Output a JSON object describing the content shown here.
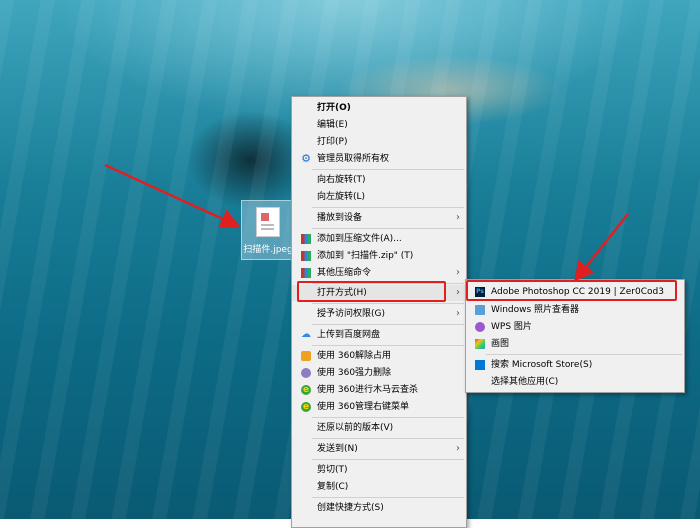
{
  "desktop": {
    "file_icon_label": "扫描件.jpeg"
  },
  "context_menu": {
    "items": [
      {
        "label": "打开(O)",
        "icon": ""
      },
      {
        "label": "编辑(E)",
        "icon": ""
      },
      {
        "label": "打印(P)",
        "icon": ""
      },
      {
        "label": "管理员取得所有权",
        "icon": "gear-icon"
      },
      {
        "label": "向右旋转(T)",
        "icon": ""
      },
      {
        "label": "向左旋转(L)",
        "icon": ""
      },
      {
        "label": "播放到设备",
        "icon": "",
        "submenu": true
      },
      {
        "label": "添加到压缩文件(A)...",
        "icon": "archive-icon"
      },
      {
        "label": "添加到 \"扫描件.zip\" (T)",
        "icon": "archive-icon"
      },
      {
        "label": "其他压缩命令",
        "icon": "archive-icon",
        "submenu": true
      },
      {
        "label": "打开方式(H)",
        "icon": "",
        "submenu": true
      },
      {
        "label": "授予访问权限(G)",
        "icon": "",
        "submenu": true
      },
      {
        "label": "上传到百度网盘",
        "icon": "cloud-icon"
      },
      {
        "label": "使用 360解除占用",
        "icon": "360-unlock-icon"
      },
      {
        "label": "使用 360强力删除",
        "icon": "360-delete-icon"
      },
      {
        "label": "使用 360进行木马云查杀",
        "icon": "360-scan-icon"
      },
      {
        "label": "使用 360管理右键菜单",
        "icon": "360-menu-icon"
      },
      {
        "label": "还原以前的版本(V)",
        "icon": ""
      },
      {
        "label": "发送到(N)",
        "icon": "",
        "submenu": true
      },
      {
        "label": "剪切(T)",
        "icon": ""
      },
      {
        "label": "复制(C)",
        "icon": ""
      },
      {
        "label": "创建快捷方式(S)",
        "icon": ""
      }
    ]
  },
  "open_with_menu": {
    "items": [
      {
        "label": "Adobe Photoshop CC 2019 | Zer0Cod3",
        "icon": "photoshop-icon"
      },
      {
        "label": "Windows 照片查看器",
        "icon": "photo-viewer-icon"
      },
      {
        "label": "WPS 图片",
        "icon": "wps-icon"
      },
      {
        "label": "画图",
        "icon": "paint-icon"
      },
      {
        "label": "搜索 Microsoft Store(S)",
        "icon": "store-icon"
      },
      {
        "label": "选择其他应用(C)",
        "icon": ""
      }
    ]
  },
  "colors": {
    "highlight_border": "#e02020",
    "arrow": "#e02020",
    "menu_bg": "#f0f0f0"
  }
}
